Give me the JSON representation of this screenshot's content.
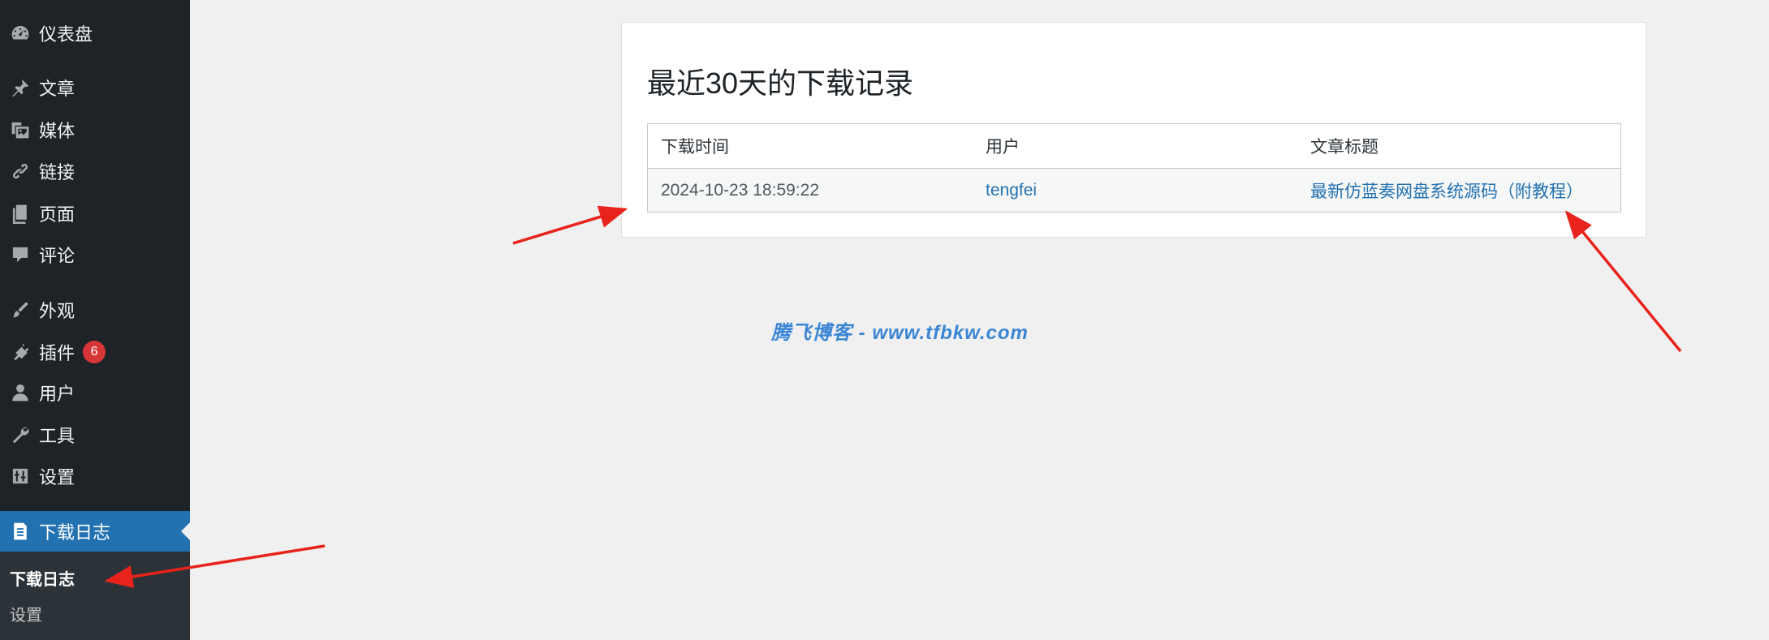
{
  "sidebar": {
    "items": [
      {
        "label": "仪表盘",
        "icon": "dashboard-icon"
      },
      {
        "label": "文章",
        "icon": "pin-icon"
      },
      {
        "label": "媒体",
        "icon": "media-icon"
      },
      {
        "label": "链接",
        "icon": "link-icon"
      },
      {
        "label": "页面",
        "icon": "pages-icon"
      },
      {
        "label": "评论",
        "icon": "comment-icon"
      },
      {
        "label": "外观",
        "icon": "brush-icon"
      },
      {
        "label": "插件",
        "icon": "plugin-icon",
        "badge": "6"
      },
      {
        "label": "用户",
        "icon": "user-icon"
      },
      {
        "label": "工具",
        "icon": "wrench-icon"
      },
      {
        "label": "设置",
        "icon": "settings-icon"
      },
      {
        "label": "下载日志",
        "icon": "document-icon"
      }
    ],
    "submenu": [
      {
        "label": "下载日志"
      },
      {
        "label": "设置"
      }
    ]
  },
  "main": {
    "title": "最近30天的下载记录",
    "table": {
      "headers": [
        "下载时间",
        "用户",
        "文章标题"
      ],
      "rows": [
        [
          "2024-10-23 18:59:22",
          "tengfei",
          "最新仿蓝奏网盘系统源码（附教程）"
        ]
      ]
    }
  },
  "watermark": "腾飞博客 - www.tfbkw.com",
  "colors": {
    "sidebar_bg": "#1d2327",
    "active_bg": "#2271b1",
    "badge": "#d63638",
    "link": "#2271b1",
    "annotation_arrow": "#e8231b"
  }
}
